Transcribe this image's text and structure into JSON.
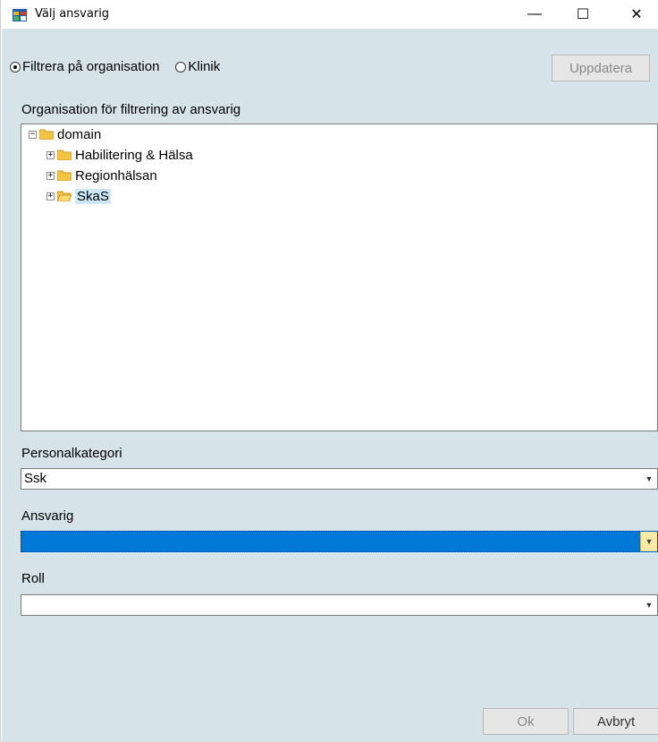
{
  "window": {
    "title": "Välj ansvarig",
    "minimize_glyph": "—",
    "maximize_glyph": "☐",
    "close_glyph": "✕"
  },
  "filter": {
    "option_org": "Filtrera på organisation",
    "option_clinic": "Klinik",
    "selected": "org"
  },
  "buttons": {
    "update": "Uppdatera",
    "ok": "Ok",
    "cancel": "Avbryt"
  },
  "org_label": "Organisation för filtrering av ansvarig",
  "tree": {
    "root": "domain",
    "children": [
      "Habilitering & Hälsa",
      "Regionhälsan",
      "SkaS"
    ],
    "selected": "SkaS"
  },
  "personalkategori": {
    "label": "Personalkategori",
    "value": "Ssk"
  },
  "ansvarig": {
    "label": "Ansvarig",
    "value": ""
  },
  "roll": {
    "label": "Roll",
    "value": ""
  },
  "colors": {
    "background": "#d6e4e9",
    "selection": "#0078d7",
    "highlight": "#cce8f4"
  },
  "icons": {
    "app": "window-app-icon",
    "folder": "folder-icon",
    "folder_open": "folder-open-icon",
    "expand": "plus-box-icon",
    "collapse": "minus-box-icon",
    "dropdown": "dropdown-arrow-icon"
  }
}
